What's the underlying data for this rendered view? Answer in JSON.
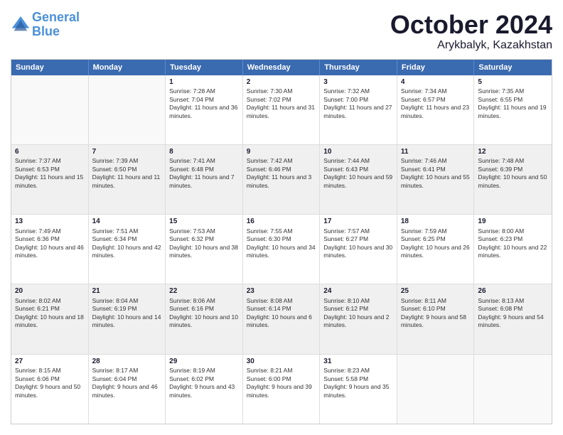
{
  "logo": {
    "line1": "General",
    "line2": "Blue"
  },
  "title": "October 2024",
  "location": "Arykbalyk, Kazakhstan",
  "days_header": [
    "Sunday",
    "Monday",
    "Tuesday",
    "Wednesday",
    "Thursday",
    "Friday",
    "Saturday"
  ],
  "weeks": [
    [
      {
        "day": "",
        "sunrise": "",
        "sunset": "",
        "daylight": "",
        "shaded": false,
        "empty": true
      },
      {
        "day": "",
        "sunrise": "",
        "sunset": "",
        "daylight": "",
        "shaded": false,
        "empty": true
      },
      {
        "day": "1",
        "sunrise": "Sunrise: 7:28 AM",
        "sunset": "Sunset: 7:04 PM",
        "daylight": "Daylight: 11 hours and 36 minutes.",
        "shaded": false,
        "empty": false
      },
      {
        "day": "2",
        "sunrise": "Sunrise: 7:30 AM",
        "sunset": "Sunset: 7:02 PM",
        "daylight": "Daylight: 11 hours and 31 minutes.",
        "shaded": false,
        "empty": false
      },
      {
        "day": "3",
        "sunrise": "Sunrise: 7:32 AM",
        "sunset": "Sunset: 7:00 PM",
        "daylight": "Daylight: 11 hours and 27 minutes.",
        "shaded": false,
        "empty": false
      },
      {
        "day": "4",
        "sunrise": "Sunrise: 7:34 AM",
        "sunset": "Sunset: 6:57 PM",
        "daylight": "Daylight: 11 hours and 23 minutes.",
        "shaded": false,
        "empty": false
      },
      {
        "day": "5",
        "sunrise": "Sunrise: 7:35 AM",
        "sunset": "Sunset: 6:55 PM",
        "daylight": "Daylight: 11 hours and 19 minutes.",
        "shaded": false,
        "empty": false
      }
    ],
    [
      {
        "day": "6",
        "sunrise": "Sunrise: 7:37 AM",
        "sunset": "Sunset: 6:53 PM",
        "daylight": "Daylight: 11 hours and 15 minutes.",
        "shaded": true,
        "empty": false
      },
      {
        "day": "7",
        "sunrise": "Sunrise: 7:39 AM",
        "sunset": "Sunset: 6:50 PM",
        "daylight": "Daylight: 11 hours and 11 minutes.",
        "shaded": true,
        "empty": false
      },
      {
        "day": "8",
        "sunrise": "Sunrise: 7:41 AM",
        "sunset": "Sunset: 6:48 PM",
        "daylight": "Daylight: 11 hours and 7 minutes.",
        "shaded": true,
        "empty": false
      },
      {
        "day": "9",
        "sunrise": "Sunrise: 7:42 AM",
        "sunset": "Sunset: 6:46 PM",
        "daylight": "Daylight: 11 hours and 3 minutes.",
        "shaded": true,
        "empty": false
      },
      {
        "day": "10",
        "sunrise": "Sunrise: 7:44 AM",
        "sunset": "Sunset: 6:43 PM",
        "daylight": "Daylight: 10 hours and 59 minutes.",
        "shaded": true,
        "empty": false
      },
      {
        "day": "11",
        "sunrise": "Sunrise: 7:46 AM",
        "sunset": "Sunset: 6:41 PM",
        "daylight": "Daylight: 10 hours and 55 minutes.",
        "shaded": true,
        "empty": false
      },
      {
        "day": "12",
        "sunrise": "Sunrise: 7:48 AM",
        "sunset": "Sunset: 6:39 PM",
        "daylight": "Daylight: 10 hours and 50 minutes.",
        "shaded": true,
        "empty": false
      }
    ],
    [
      {
        "day": "13",
        "sunrise": "Sunrise: 7:49 AM",
        "sunset": "Sunset: 6:36 PM",
        "daylight": "Daylight: 10 hours and 46 minutes.",
        "shaded": false,
        "empty": false
      },
      {
        "day": "14",
        "sunrise": "Sunrise: 7:51 AM",
        "sunset": "Sunset: 6:34 PM",
        "daylight": "Daylight: 10 hours and 42 minutes.",
        "shaded": false,
        "empty": false
      },
      {
        "day": "15",
        "sunrise": "Sunrise: 7:53 AM",
        "sunset": "Sunset: 6:32 PM",
        "daylight": "Daylight: 10 hours and 38 minutes.",
        "shaded": false,
        "empty": false
      },
      {
        "day": "16",
        "sunrise": "Sunrise: 7:55 AM",
        "sunset": "Sunset: 6:30 PM",
        "daylight": "Daylight: 10 hours and 34 minutes.",
        "shaded": false,
        "empty": false
      },
      {
        "day": "17",
        "sunrise": "Sunrise: 7:57 AM",
        "sunset": "Sunset: 6:27 PM",
        "daylight": "Daylight: 10 hours and 30 minutes.",
        "shaded": false,
        "empty": false
      },
      {
        "day": "18",
        "sunrise": "Sunrise: 7:59 AM",
        "sunset": "Sunset: 6:25 PM",
        "daylight": "Daylight: 10 hours and 26 minutes.",
        "shaded": false,
        "empty": false
      },
      {
        "day": "19",
        "sunrise": "Sunrise: 8:00 AM",
        "sunset": "Sunset: 6:23 PM",
        "daylight": "Daylight: 10 hours and 22 minutes.",
        "shaded": false,
        "empty": false
      }
    ],
    [
      {
        "day": "20",
        "sunrise": "Sunrise: 8:02 AM",
        "sunset": "Sunset: 6:21 PM",
        "daylight": "Daylight: 10 hours and 18 minutes.",
        "shaded": true,
        "empty": false
      },
      {
        "day": "21",
        "sunrise": "Sunrise: 8:04 AM",
        "sunset": "Sunset: 6:19 PM",
        "daylight": "Daylight: 10 hours and 14 minutes.",
        "shaded": true,
        "empty": false
      },
      {
        "day": "22",
        "sunrise": "Sunrise: 8:06 AM",
        "sunset": "Sunset: 6:16 PM",
        "daylight": "Daylight: 10 hours and 10 minutes.",
        "shaded": true,
        "empty": false
      },
      {
        "day": "23",
        "sunrise": "Sunrise: 8:08 AM",
        "sunset": "Sunset: 6:14 PM",
        "daylight": "Daylight: 10 hours and 6 minutes.",
        "shaded": true,
        "empty": false
      },
      {
        "day": "24",
        "sunrise": "Sunrise: 8:10 AM",
        "sunset": "Sunset: 6:12 PM",
        "daylight": "Daylight: 10 hours and 2 minutes.",
        "shaded": true,
        "empty": false
      },
      {
        "day": "25",
        "sunrise": "Sunrise: 8:11 AM",
        "sunset": "Sunset: 6:10 PM",
        "daylight": "Daylight: 9 hours and 58 minutes.",
        "shaded": true,
        "empty": false
      },
      {
        "day": "26",
        "sunrise": "Sunrise: 8:13 AM",
        "sunset": "Sunset: 6:08 PM",
        "daylight": "Daylight: 9 hours and 54 minutes.",
        "shaded": true,
        "empty": false
      }
    ],
    [
      {
        "day": "27",
        "sunrise": "Sunrise: 8:15 AM",
        "sunset": "Sunset: 6:06 PM",
        "daylight": "Daylight: 9 hours and 50 minutes.",
        "shaded": false,
        "empty": false
      },
      {
        "day": "28",
        "sunrise": "Sunrise: 8:17 AM",
        "sunset": "Sunset: 6:04 PM",
        "daylight": "Daylight: 9 hours and 46 minutes.",
        "shaded": false,
        "empty": false
      },
      {
        "day": "29",
        "sunrise": "Sunrise: 8:19 AM",
        "sunset": "Sunset: 6:02 PM",
        "daylight": "Daylight: 9 hours and 43 minutes.",
        "shaded": false,
        "empty": false
      },
      {
        "day": "30",
        "sunrise": "Sunrise: 8:21 AM",
        "sunset": "Sunset: 6:00 PM",
        "daylight": "Daylight: 9 hours and 39 minutes.",
        "shaded": false,
        "empty": false
      },
      {
        "day": "31",
        "sunrise": "Sunrise: 8:23 AM",
        "sunset": "Sunset: 5:58 PM",
        "daylight": "Daylight: 9 hours and 35 minutes.",
        "shaded": false,
        "empty": false
      },
      {
        "day": "",
        "sunrise": "",
        "sunset": "",
        "daylight": "",
        "shaded": false,
        "empty": true
      },
      {
        "day": "",
        "sunrise": "",
        "sunset": "",
        "daylight": "",
        "shaded": false,
        "empty": true
      }
    ]
  ]
}
